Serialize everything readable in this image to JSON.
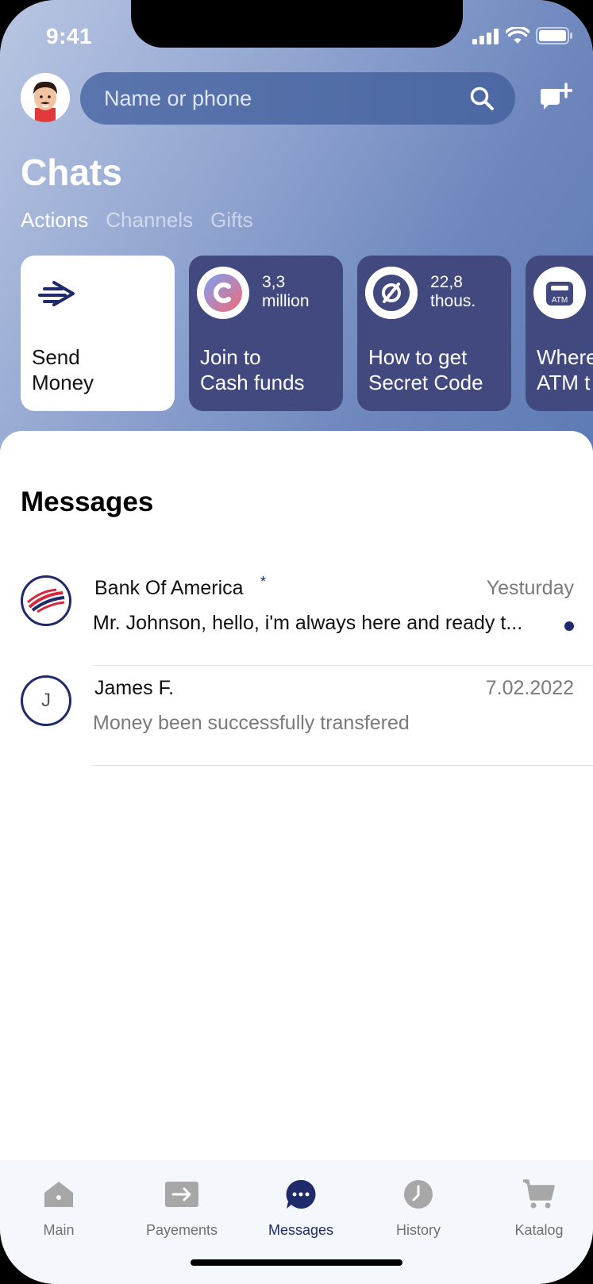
{
  "status": {
    "time": "9:41"
  },
  "search": {
    "placeholder": "Name or phone"
  },
  "header": {
    "title": "Chats"
  },
  "tabs": [
    {
      "label": "Actions",
      "active": true
    },
    {
      "label": "Channels",
      "active": false
    },
    {
      "label": "Gifts",
      "active": false
    }
  ],
  "cards": [
    {
      "label_line1": "Send",
      "label_line2": "Money",
      "icon": "send-arrow-icon"
    },
    {
      "count_line1": "3,3",
      "count_line2": "million",
      "label_line1": "Join to",
      "label_line2": "Cash funds",
      "icon": "cash-c-logo-icon"
    },
    {
      "count_line1": "22,8",
      "count_line2": "thous.",
      "label_line1": "How to get",
      "label_line2": "Secret Code",
      "icon": "hidden-eye-icon"
    },
    {
      "label_line1": "Where",
      "label_line2": "ATM t",
      "icon": "atm-icon",
      "icon_text": "ATM"
    }
  ],
  "messages": {
    "title": "Messages",
    "items": [
      {
        "name": "Bank Of America",
        "verified_mark": "*",
        "date": "Yesturday",
        "preview": "Mr. Johnson, hello, i'm always here and ready t...",
        "unread": true,
        "avatar": "bank-of-america-logo"
      },
      {
        "name": "James F.",
        "initial": "J",
        "date": "7.02.2022",
        "preview": "Money been successfully transfered",
        "unread": false
      }
    ]
  },
  "tabbar": [
    {
      "label": "Main",
      "icon": "home-icon",
      "active": false
    },
    {
      "label": "Payements",
      "icon": "transfer-arrow-icon",
      "active": false
    },
    {
      "label": "Messages",
      "icon": "chat-bubble-icon",
      "active": true
    },
    {
      "label": "History",
      "icon": "clock-icon",
      "active": false
    },
    {
      "label": "Katalog",
      "icon": "cart-icon",
      "active": false
    }
  ],
  "colors": {
    "accent": "#1f2a6b",
    "card_bg": "#42497f",
    "header_gradient_start": "#b9c6e2",
    "header_gradient_end": "#5f7bb5"
  }
}
